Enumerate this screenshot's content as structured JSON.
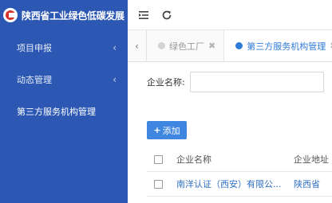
{
  "brand": {
    "logo_icon": "red-circle-logo",
    "title": "陕西省工业绿色低碳发展"
  },
  "sidebar": {
    "items": [
      {
        "label": "项目申报",
        "caret": "‹"
      },
      {
        "label": "动态管理",
        "caret": "‹"
      },
      {
        "label": "第三方服务机构管理"
      }
    ]
  },
  "topbar": {
    "icons": [
      "menu-collapse-icon",
      "refresh-icon"
    ]
  },
  "tabs": {
    "prev": "‹",
    "items": [
      {
        "label": "绿色工厂",
        "close": "✖",
        "active": false
      },
      {
        "label": "第三方服务机构管理",
        "close": "✖",
        "active": true
      }
    ]
  },
  "search": {
    "label": "企业名称:",
    "value": ""
  },
  "toolbar": {
    "add_label": "添加",
    "add_icon": "+"
  },
  "table": {
    "columns": [
      "企业名称",
      "企业地址"
    ],
    "rows": [
      {
        "name": "南洋认证（西安）有限公...",
        "address": "陕西省"
      }
    ]
  },
  "colors": {
    "sidebar_bg": "#2c58b4",
    "accent": "#2f7bd8",
    "button": "#3e86e0",
    "logo": "#d9312c"
  }
}
